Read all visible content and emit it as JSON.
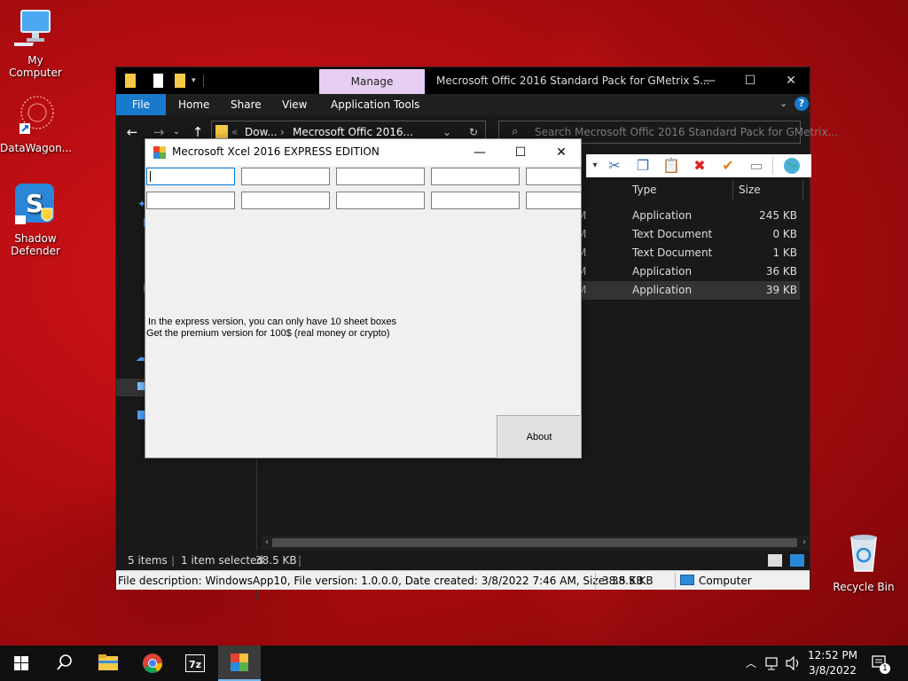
{
  "desktop": {
    "icons": [
      {
        "label": "My Computer"
      },
      {
        "label": "DataWagon..."
      },
      {
        "label_line1": "Shadow",
        "label_line2": "Defender"
      },
      {
        "label": "Recycle Bin"
      }
    ]
  },
  "explorer": {
    "title": "Mecrosoft Offic 2016 Standard Pack for GMetrix S...",
    "manage_tab": "Manage",
    "ribbon_tabs": [
      "File",
      "Home",
      "Share",
      "View",
      "Application Tools"
    ],
    "address": {
      "part1": "Dow...",
      "part2": "Mecrosoft Offic 2016..."
    },
    "search_placeholder": "Search Mecrosoft Offic 2016 Standard Pack for GMetrix...",
    "columns": {
      "type": "Type",
      "size": "Size"
    },
    "rows": [
      {
        "m": "M",
        "type": "Application",
        "size": "245 KB"
      },
      {
        "m": "M",
        "type": "Text Document",
        "size": "0 KB"
      },
      {
        "m": "M",
        "type": "Text Document",
        "size": "1 KB"
      },
      {
        "m": "M",
        "type": "Application",
        "size": "36 KB"
      },
      {
        "m": "M",
        "type": "Application",
        "size": "39 KB",
        "selected": true
      }
    ],
    "status": {
      "items": "5 items",
      "selected": "1 item selected",
      "sel_size": "38.5 KB"
    },
    "details_bar": {
      "description": "File description: WindowsApp10, File version: 1.0.0.0, Date created: 3/8/2022 7:46 AM, Size: 38.5 KB",
      "size": "38.5 KB",
      "location": "Computer"
    }
  },
  "xcel": {
    "title": "Mecrosoft Xcel 2016 EXPRESS EDITION",
    "message_line1": "In the express version, you can only have 10 sheet boxes",
    "message_line2": "Get the premium version for 100$ (real money or crypto)",
    "about_label": "About"
  },
  "taskbar": {
    "time": "12:52 PM",
    "date": "3/8/2022",
    "notification_count": "1",
    "items": [
      "start-icon",
      "search-icon",
      "file-explorer-icon",
      "chrome-icon",
      "7zip-icon",
      "xcel-app-icon"
    ]
  },
  "colors": {
    "accent": "#1979ca",
    "manage_tab": "#e6cff3",
    "desktop_red": "#c8101a"
  }
}
